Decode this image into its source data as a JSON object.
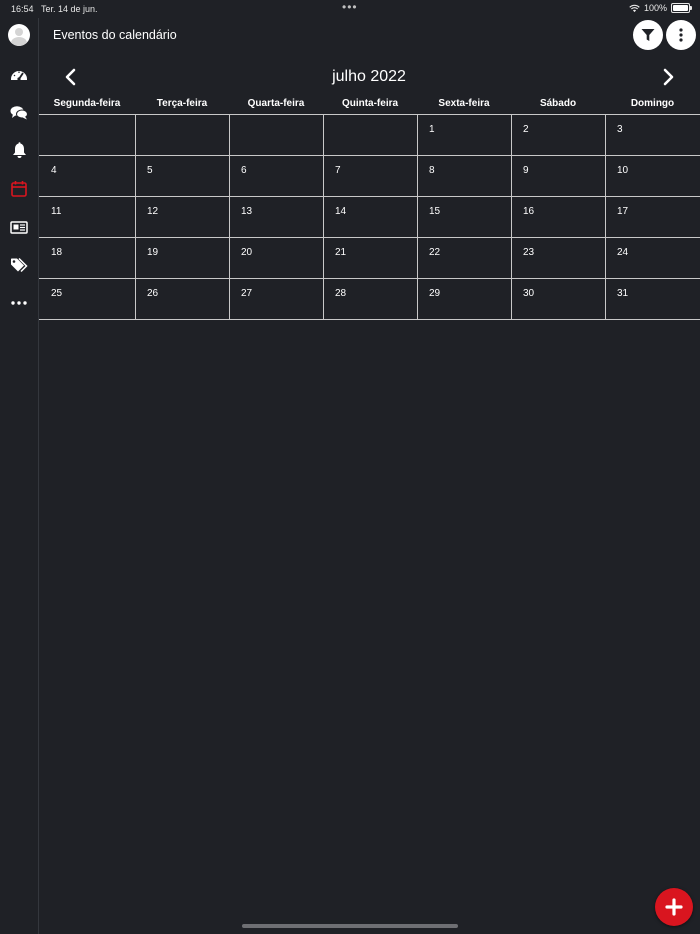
{
  "status_bar": {
    "time": "16:54",
    "date": "Ter. 14 de jun.",
    "battery": "100%"
  },
  "sidebar": {
    "items": [
      {
        "icon": "avatar-icon",
        "active": false
      },
      {
        "icon": "dashboard-gauge-icon",
        "active": false
      },
      {
        "icon": "chat-bubbles-icon",
        "active": false
      },
      {
        "icon": "bell-icon",
        "active": false
      },
      {
        "icon": "calendar-icon",
        "active": true
      },
      {
        "icon": "newspaper-icon",
        "active": false
      },
      {
        "icon": "tags-icon",
        "active": false
      },
      {
        "icon": "more-dots-icon",
        "active": false
      }
    ],
    "active_color": "#d9151f"
  },
  "header": {
    "title": "Eventos do calendário"
  },
  "calendar": {
    "month_label": "julho 2022",
    "weekdays": [
      "Segunda-feira",
      "Terça-feira",
      "Quarta-feira",
      "Quinta-feira",
      "Sexta-feira",
      "Sábado",
      "Domingo"
    ],
    "weeks": [
      [
        "",
        "",
        "",
        "",
        "1",
        "2",
        "3"
      ],
      [
        "4",
        "5",
        "6",
        "7",
        "8",
        "9",
        "10"
      ],
      [
        "11",
        "12",
        "13",
        "14",
        "15",
        "16",
        "17"
      ],
      [
        "18",
        "19",
        "20",
        "21",
        "22",
        "23",
        "24"
      ],
      [
        "25",
        "26",
        "27",
        "28",
        "29",
        "30",
        "31"
      ]
    ]
  },
  "colors": {
    "background": "#1f2126",
    "accent": "#d9151f",
    "grid_line": "#c8c8c8"
  }
}
